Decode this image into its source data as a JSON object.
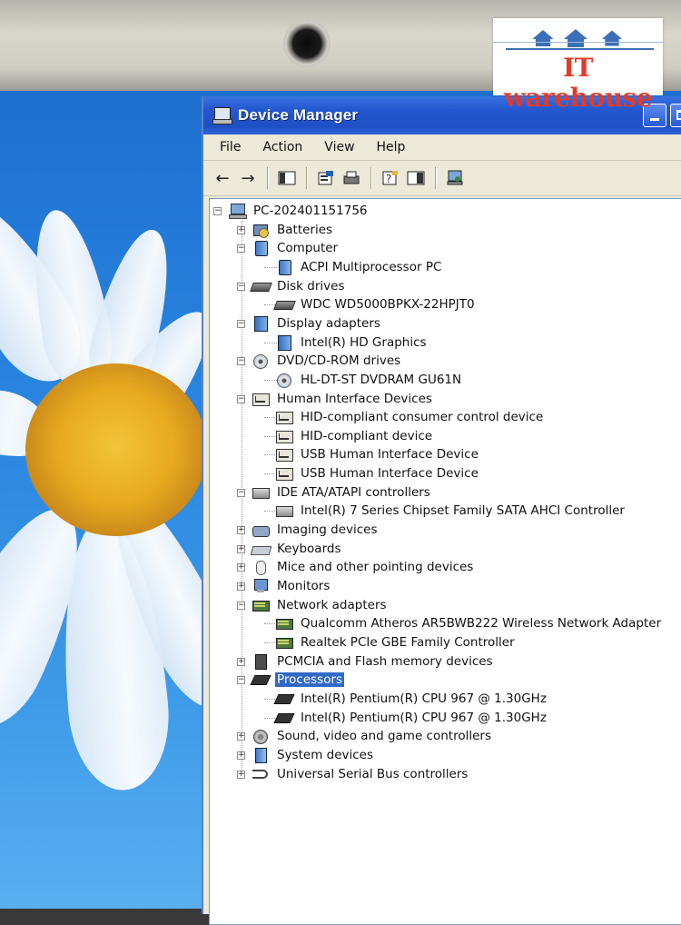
{
  "window": {
    "title": "Device Manager",
    "controls": [
      "minimize",
      "maximize"
    ]
  },
  "menu": [
    "File",
    "Action",
    "View",
    "Help"
  ],
  "toolbar": {
    "icons": [
      "back-icon",
      "forward-icon",
      "console-tree-icon",
      "properties-icon",
      "print-icon",
      "help-icon",
      "show-hide-icon",
      "scan-hardware-icon"
    ]
  },
  "tree": [
    {
      "label": "PC-202401151756",
      "level": 0,
      "state": "expanded",
      "icon": "computer"
    },
    {
      "label": "Batteries",
      "level": 1,
      "state": "collapsed",
      "icon": "battery"
    },
    {
      "label": "Computer",
      "level": 1,
      "state": "expanded",
      "icon": "computer-category"
    },
    {
      "label": "ACPI Multiprocessor PC",
      "level": 2,
      "state": "leaf",
      "icon": "computer-category"
    },
    {
      "label": "Disk drives",
      "level": 1,
      "state": "expanded",
      "icon": "disk-drive"
    },
    {
      "label": "WDC WD5000BPKX-22HPJT0",
      "level": 2,
      "state": "leaf",
      "icon": "disk-drive"
    },
    {
      "label": "Display adapters",
      "level": 1,
      "state": "expanded",
      "icon": "display-adapter"
    },
    {
      "label": "Intel(R) HD Graphics",
      "level": 2,
      "state": "leaf",
      "icon": "display-adapter"
    },
    {
      "label": "DVD/CD-ROM drives",
      "level": 1,
      "state": "expanded",
      "icon": "dvd-drive"
    },
    {
      "label": "HL-DT-ST DVDRAM GU61N",
      "level": 2,
      "state": "leaf",
      "icon": "dvd-drive"
    },
    {
      "label": "Human Interface Devices",
      "level": 1,
      "state": "expanded",
      "icon": "hid"
    },
    {
      "label": "HID-compliant consumer control device",
      "level": 2,
      "state": "leaf",
      "icon": "hid"
    },
    {
      "label": "HID-compliant device",
      "level": 2,
      "state": "leaf",
      "icon": "hid"
    },
    {
      "label": "USB Human Interface Device",
      "level": 2,
      "state": "leaf",
      "icon": "hid"
    },
    {
      "label": "USB Human Interface Device",
      "level": 2,
      "state": "leaf",
      "icon": "hid"
    },
    {
      "label": "IDE ATA/ATAPI controllers",
      "level": 1,
      "state": "expanded",
      "icon": "ide-controller"
    },
    {
      "label": "Intel(R) 7 Series Chipset Family SATA AHCI Controller",
      "level": 2,
      "state": "leaf",
      "icon": "ide-controller"
    },
    {
      "label": "Imaging devices",
      "level": 1,
      "state": "collapsed",
      "icon": "imaging"
    },
    {
      "label": "Keyboards",
      "level": 1,
      "state": "collapsed",
      "icon": "keyboard"
    },
    {
      "label": "Mice and other pointing devices",
      "level": 1,
      "state": "collapsed",
      "icon": "mouse"
    },
    {
      "label": "Monitors",
      "level": 1,
      "state": "collapsed",
      "icon": "monitor"
    },
    {
      "label": "Network adapters",
      "level": 1,
      "state": "expanded",
      "icon": "network-adapter"
    },
    {
      "label": "Qualcomm Atheros AR5BWB222 Wireless Network Adapter",
      "level": 2,
      "state": "leaf",
      "icon": "network-adapter"
    },
    {
      "label": "Realtek PCIe GBE Family Controller",
      "level": 2,
      "state": "leaf",
      "icon": "network-adapter"
    },
    {
      "label": "PCMCIA and Flash memory devices",
      "level": 1,
      "state": "collapsed",
      "icon": "pcmcia"
    },
    {
      "label": "Processors",
      "level": 1,
      "state": "expanded",
      "icon": "processor",
      "selected": true
    },
    {
      "label": "Intel(R) Pentium(R) CPU 967 @ 1.30GHz",
      "level": 2,
      "state": "leaf",
      "icon": "processor"
    },
    {
      "label": "Intel(R) Pentium(R) CPU 967 @ 1.30GHz",
      "level": 2,
      "state": "leaf",
      "icon": "processor"
    },
    {
      "label": "Sound, video and game controllers",
      "level": 1,
      "state": "collapsed",
      "icon": "sound"
    },
    {
      "label": "System devices",
      "level": 1,
      "state": "collapsed",
      "icon": "system-devices"
    },
    {
      "label": "Universal Serial Bus controllers",
      "level": 1,
      "state": "collapsed",
      "icon": "usb"
    }
  ],
  "logo": {
    "text": "IT warehouse"
  },
  "colors": {
    "titlebar": "#2458d0",
    "selection": "#3169c6",
    "logo_text": "#e23a2b",
    "logo_houses": "#3b6fb7"
  }
}
